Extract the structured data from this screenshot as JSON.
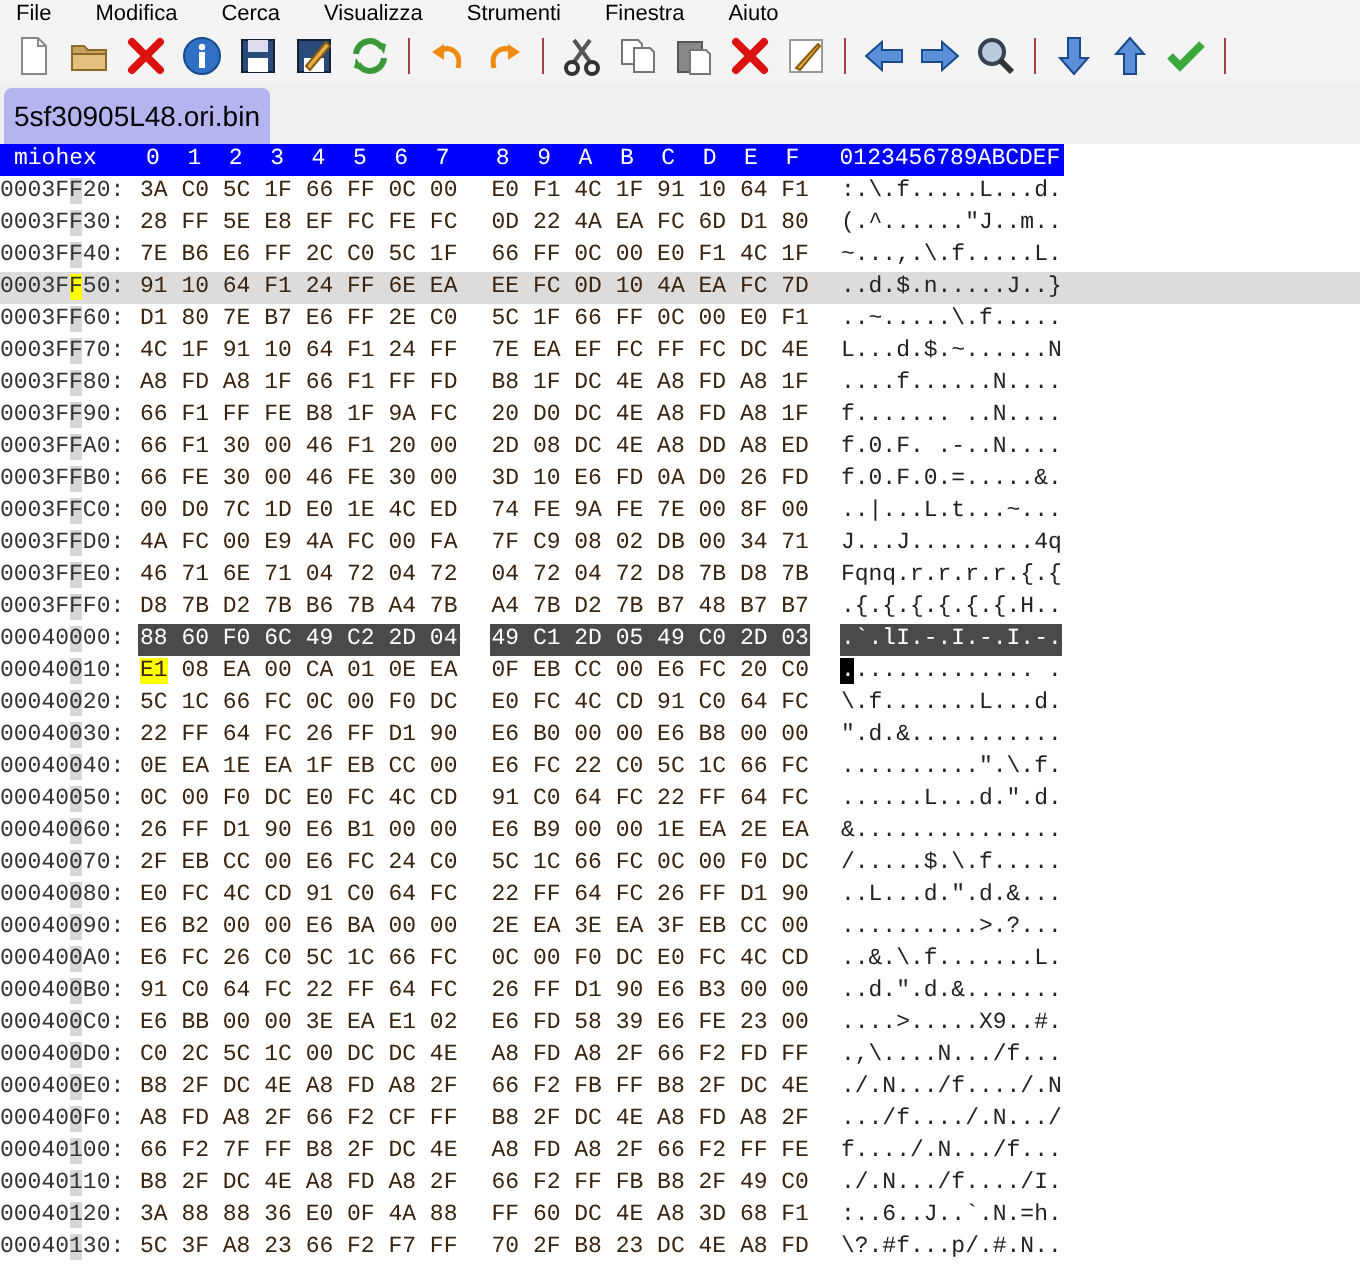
{
  "menu": [
    "File",
    "Modifica",
    "Cerca",
    "Visualizza",
    "Strumenti",
    "Finestra",
    "Aiuto"
  ],
  "toolbar": [
    {
      "kind": "new"
    },
    {
      "kind": "open"
    },
    {
      "kind": "close"
    },
    {
      "kind": "info"
    },
    {
      "kind": "save"
    },
    {
      "kind": "save_as"
    },
    {
      "kind": "reload"
    },
    {
      "kind": "separator"
    },
    {
      "kind": "undo"
    },
    {
      "kind": "redo"
    },
    {
      "kind": "separator"
    },
    {
      "kind": "cut"
    },
    {
      "kind": "copy"
    },
    {
      "kind": "paste"
    },
    {
      "kind": "delete"
    },
    {
      "kind": "edit"
    },
    {
      "kind": "separator"
    },
    {
      "kind": "back"
    },
    {
      "kind": "forward"
    },
    {
      "kind": "find"
    },
    {
      "kind": "separator"
    },
    {
      "kind": "down"
    },
    {
      "kind": "up"
    },
    {
      "kind": "apply"
    },
    {
      "kind": "separator"
    }
  ],
  "tabs": [
    {
      "label": "5sf30905L48.ori.bin",
      "selected": true
    }
  ],
  "header": {
    "corner": "miohex",
    "columns": [
      "0",
      "1",
      "2",
      "3",
      "4",
      "5",
      "6",
      "7",
      "8",
      "9",
      "A",
      "B",
      "C",
      "D",
      "E",
      "F"
    ],
    "ascii": "0123456789ABCDEF"
  },
  "rows": [
    {
      "address": "0003FF20:",
      "bytes": "3A C0 5C 1F 66 FF 0C 00 E0 F1 4C 1F 91 10 64 F1",
      "ascii": ":.\\.f.....L...d.",
      "current": false,
      "selected": false,
      "cursor": false
    },
    {
      "address": "0003FF30:",
      "bytes": "28 FF 5E E8 EF FC FE FC 0D 22 4A EA FC 6D D1 80",
      "ascii": "(.^......\"J..m..",
      "current": false,
      "selected": false,
      "cursor": false
    },
    {
      "address": "0003FF40:",
      "bytes": "7E B6 E6 FF 2C C0 5C 1F 66 FF 0C 00 E0 F1 4C 1F",
      "ascii": "~...,.\\.f.....L.",
      "current": false,
      "selected": false,
      "cursor": false
    },
    {
      "address": "0003FF50:",
      "bytes": "91 10 64 F1 24 FF 6E EA EE FC 0D 10 4A EA FC 7D",
      "ascii": "..d.$.n.....J..}",
      "current": true,
      "selected": false,
      "cursor": false
    },
    {
      "address": "0003FF60:",
      "bytes": "D1 80 7E B7 E6 FF 2E C0 5C 1F 66 FF 0C 00 E0 F1",
      "ascii": "..~.....\\.f.....",
      "current": false,
      "selected": false,
      "cursor": false
    },
    {
      "address": "0003FF70:",
      "bytes": "4C 1F 91 10 64 F1 24 FF 7E EA EF FC FF FC DC 4E",
      "ascii": "L...d.$.~......N",
      "current": false,
      "selected": false,
      "cursor": false
    },
    {
      "address": "0003FF80:",
      "bytes": "A8 FD A8 1F 66 F1 FF FD B8 1F DC 4E A8 FD A8 1F",
      "ascii": "....f......N....",
      "current": false,
      "selected": false,
      "cursor": false
    },
    {
      "address": "0003FF90:",
      "bytes": "66 F1 FF FE B8 1F 9A FC 20 D0 DC 4E A8 FD A8 1F",
      "ascii": "f....... ..N....",
      "current": false,
      "selected": false,
      "cursor": false
    },
    {
      "address": "0003FFA0:",
      "bytes": "66 F1 30 00 46 F1 20 00 2D 08 DC 4E A8 DD A8 ED",
      "ascii": "f.0.F. .-..N....",
      "current": false,
      "selected": false,
      "cursor": false
    },
    {
      "address": "0003FFB0:",
      "bytes": "66 FE 30 00 46 FE 30 00 3D 10 E6 FD 0A D0 26 FD",
      "ascii": "f.0.F.0.=.....&.",
      "current": false,
      "selected": false,
      "cursor": false
    },
    {
      "address": "0003FFC0:",
      "bytes": "00 D0 7C 1D E0 1E 4C ED 74 FE 9A FE 7E 00 8F 00",
      "ascii": "..|...L.t...~...",
      "current": false,
      "selected": false,
      "cursor": false
    },
    {
      "address": "0003FFD0:",
      "bytes": "4A FC 00 E9 4A FC 00 FA 7F C9 08 02 DB 00 34 71",
      "ascii": "J...J.........4q",
      "current": false,
      "selected": false,
      "cursor": false
    },
    {
      "address": "0003FFE0:",
      "bytes": "46 71 6E 71 04 72 04 72 04 72 04 72 D8 7B D8 7B",
      "ascii": "Fqnq.r.r.r.r.{.{",
      "current": false,
      "selected": false,
      "cursor": false
    },
    {
      "address": "0003FFF0:",
      "bytes": "D8 7B D2 7B B6 7B A4 7B A4 7B D2 7B B7 48 B7 B7",
      "ascii": ".{.{.{.{.{.{.H..",
      "current": false,
      "selected": false,
      "cursor": false
    },
    {
      "address": "00040000:",
      "bytes": "88 60 F0 6C 49 C2 2D 04 49 C1 2D 05 49 C0 2D 03",
      "ascii": ".`.lI.-.I.-.I.-.",
      "current": false,
      "selected": true,
      "cursor": false
    },
    {
      "address": "00040010:",
      "bytes": "E1 08 EA 00 CA 01 0E EA 0F EB CC 00 E6 FC 20 C0",
      "ascii": ".............. .",
      "current": false,
      "selected": false,
      "cursor": true
    },
    {
      "address": "00040020:",
      "bytes": "5C 1C 66 FC 0C 00 F0 DC E0 FC 4C CD 91 C0 64 FC",
      "ascii": "\\.f.......L...d.",
      "current": false,
      "selected": false,
      "cursor": false
    },
    {
      "address": "00040030:",
      "bytes": "22 FF 64 FC 26 FF D1 90 E6 B0 00 00 E6 B8 00 00",
      "ascii": "\".d.&...........",
      "current": false,
      "selected": false,
      "cursor": false
    },
    {
      "address": "00040040:",
      "bytes": "0E EA 1E EA 1F EB CC 00 E6 FC 22 C0 5C 1C 66 FC",
      "ascii": "..........\".\\.f.",
      "current": false,
      "selected": false,
      "cursor": false
    },
    {
      "address": "00040050:",
      "bytes": "0C 00 F0 DC E0 FC 4C CD 91 C0 64 FC 22 FF 64 FC",
      "ascii": "......L...d.\".d.",
      "current": false,
      "selected": false,
      "cursor": false
    },
    {
      "address": "00040060:",
      "bytes": "26 FF D1 90 E6 B1 00 00 E6 B9 00 00 1E EA 2E EA",
      "ascii": "&...............",
      "current": false,
      "selected": false,
      "cursor": false
    },
    {
      "address": "00040070:",
      "bytes": "2F EB CC 00 E6 FC 24 C0 5C 1C 66 FC 0C 00 F0 DC",
      "ascii": "/.....$.\\.f.....",
      "current": false,
      "selected": false,
      "cursor": false
    },
    {
      "address": "00040080:",
      "bytes": "E0 FC 4C CD 91 C0 64 FC 22 FF 64 FC 26 FF D1 90",
      "ascii": "..L...d.\".d.&...",
      "current": false,
      "selected": false,
      "cursor": false
    },
    {
      "address": "00040090:",
      "bytes": "E6 B2 00 00 E6 BA 00 00 2E EA 3E EA 3F EB CC 00",
      "ascii": "..........>.?...",
      "current": false,
      "selected": false,
      "cursor": false
    },
    {
      "address": "000400A0:",
      "bytes": "E6 FC 26 C0 5C 1C 66 FC 0C 00 F0 DC E0 FC 4C CD",
      "ascii": "..&.\\.f.......L.",
      "current": false,
      "selected": false,
      "cursor": false
    },
    {
      "address": "000400B0:",
      "bytes": "91 C0 64 FC 22 FF 64 FC 26 FF D1 90 E6 B3 00 00",
      "ascii": "..d.\".d.&.......",
      "current": false,
      "selected": false,
      "cursor": false
    },
    {
      "address": "000400C0:",
      "bytes": "E6 BB 00 00 3E EA E1 02 E6 FD 58 39 E6 FE 23 00",
      "ascii": "....>.....X9..#.",
      "current": false,
      "selected": false,
      "cursor": false
    },
    {
      "address": "000400D0:",
      "bytes": "C0 2C 5C 1C 00 DC DC 4E A8 FD A8 2F 66 F2 FD FF",
      "ascii": ".,\\....N.../f...",
      "current": false,
      "selected": false,
      "cursor": false
    },
    {
      "address": "000400E0:",
      "bytes": "B8 2F DC 4E A8 FD A8 2F 66 F2 FB FF B8 2F DC 4E",
      "ascii": "./.N.../f..../.N",
      "current": false,
      "selected": false,
      "cursor": false
    },
    {
      "address": "000400F0:",
      "bytes": "A8 FD A8 2F 66 F2 CF FF B8 2F DC 4E A8 FD A8 2F",
      "ascii": ".../f..../.N.../",
      "current": false,
      "selected": false,
      "cursor": false
    },
    {
      "address": "00040100:",
      "bytes": "66 F2 7F FF B8 2F DC 4E A8 FD A8 2F 66 F2 FF FE",
      "ascii": "f..../.N.../f...",
      "current": false,
      "selected": false,
      "cursor": false
    },
    {
      "address": "00040110:",
      "bytes": "B8 2F DC 4E A8 FD A8 2F 66 F2 FF FB B8 2F 49 C0",
      "ascii": "./.N.../f..../I.",
      "current": false,
      "selected": false,
      "cursor": false
    },
    {
      "address": "00040120:",
      "bytes": "3A 88 88 36 E0 0F 4A 88 FF 60 DC 4E A8 3D 68 F1",
      "ascii": ":..6..J..`.N.=h.",
      "current": false,
      "selected": false,
      "cursor": false
    },
    {
      "address": "00040130:",
      "bytes": "5C 3F A8 23 66 F2 F7 FF 70 2F B8 23 DC 4E A8 FD",
      "ascii": "\\?.#f...p/.#.N..",
      "current": false,
      "selected": false,
      "cursor": false
    }
  ]
}
